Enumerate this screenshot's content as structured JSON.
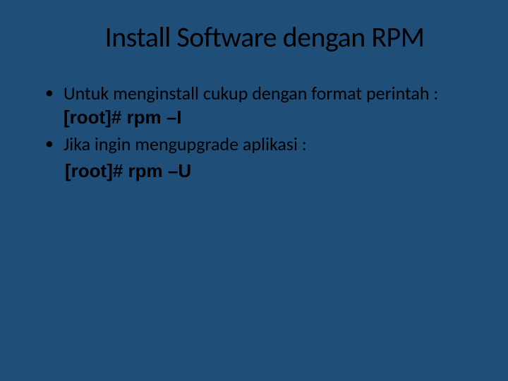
{
  "title": "Install Software dengan RPM",
  "bullets": [
    {
      "text_before": "Untuk menginstall cukup dengan format perintah : ",
      "command": "[root]# rpm –I"
    },
    {
      "text_before": "Jika ingin mengupgrade aplikasi :",
      "command_newline": "[root]# rpm –U"
    }
  ]
}
